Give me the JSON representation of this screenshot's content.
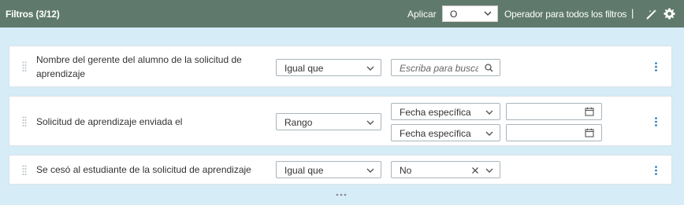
{
  "header": {
    "title": "Filtros (3/12)",
    "apply_label": "Aplicar",
    "operator_value": "O",
    "operator_description": "Operador para todos los filtros",
    "separator": "|"
  },
  "filters": [
    {
      "label_line1": "Nombre del gerente del alumno de la solicitud de",
      "label_line2": "aprendizaje",
      "operator": "Igual que",
      "search_placeholder": "Escriba para buscar"
    },
    {
      "label": "Solicitud de aprendizaje enviada el",
      "operator": "Rango",
      "date_from_type": "Fecha específica",
      "date_to_type": "Fecha específica",
      "date_from_value": "",
      "date_to_value": ""
    },
    {
      "label": "Se cesó al estudiante de la solicitud de aprendizaje",
      "operator": "Igual que",
      "value": "No"
    }
  ],
  "icons": {
    "chevron": "chevron-down-icon",
    "search": "search-icon",
    "calendar": "calendar-icon",
    "clear": "close-icon",
    "menu": "kebab-menu-icon",
    "drag": "drag-handle-icon",
    "settings": "gear-icon",
    "wand": "magic-wand-icon",
    "more": "more-horizontal-icon"
  },
  "colors": {
    "header_bg": "#5f7a6c",
    "page_bg": "#d6ecf7",
    "accent_blue": "#1a6fb5"
  }
}
